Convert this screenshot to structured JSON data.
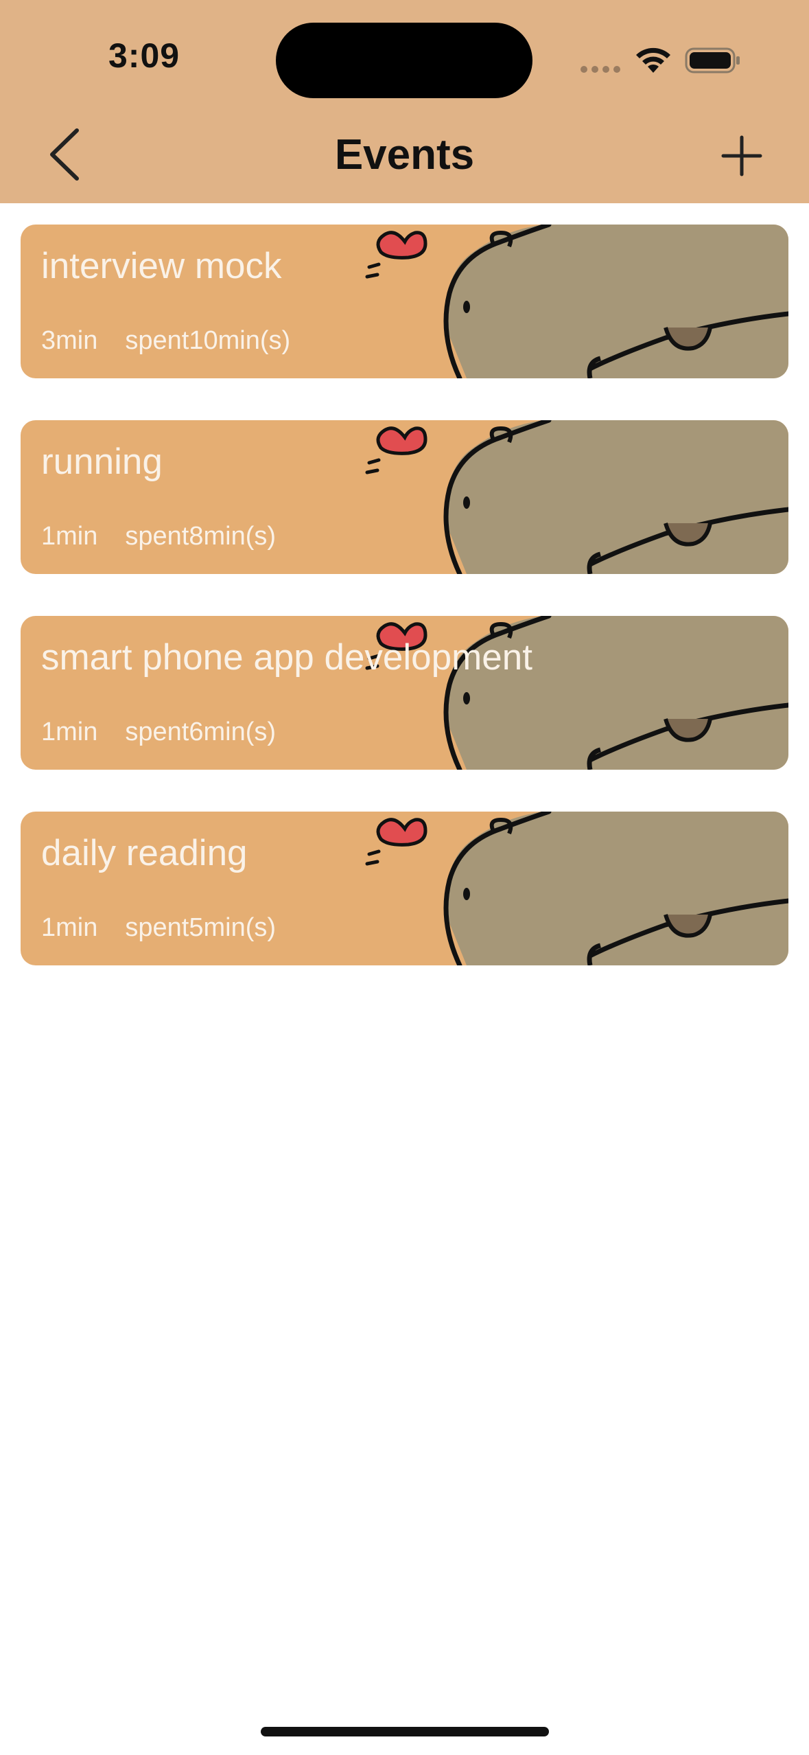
{
  "status_bar": {
    "time": "3:09"
  },
  "nav": {
    "title": "Events",
    "back_icon": "chevron-left-icon",
    "add_icon": "plus-icon"
  },
  "colors": {
    "header_bg": "#E0B387",
    "card_bg": "#E5AE73",
    "card_text": "#FAF2E8"
  },
  "events": [
    {
      "title": "interview mock",
      "duration": "3min",
      "spent": "spent10min(s)"
    },
    {
      "title": "running",
      "duration": "1min",
      "spent": "spent8min(s)"
    },
    {
      "title": "smart phone app development",
      "duration": "1min",
      "spent": "spent6min(s)"
    },
    {
      "title": "daily reading",
      "duration": "1min",
      "spent": "spent5min(s)"
    }
  ]
}
